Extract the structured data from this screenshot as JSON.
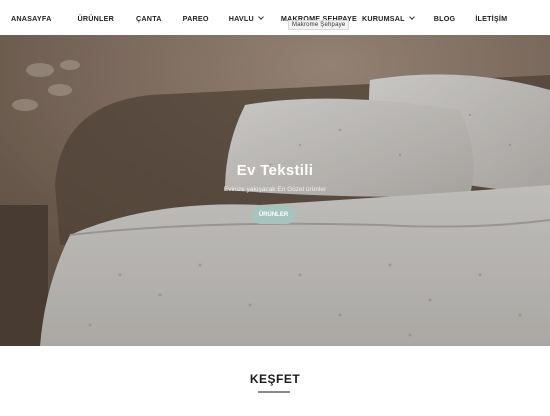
{
  "nav": {
    "items": [
      {
        "label": "ANASAYFA",
        "has_dropdown": false
      },
      {
        "label": "ÜRÜNLER",
        "has_dropdown": false
      },
      {
        "label": "ÇANTA",
        "has_dropdown": false
      },
      {
        "label": "PAREO",
        "has_dropdown": false
      },
      {
        "label": "HAVLU",
        "has_dropdown": true
      },
      {
        "label": "MAKROME SEHPAYE",
        "has_dropdown": false
      },
      {
        "label": "KURUMSAL",
        "has_dropdown": true
      },
      {
        "label": "BLOG",
        "has_dropdown": false
      },
      {
        "label": "İLETİŞİM",
        "has_dropdown": false
      }
    ],
    "tooltip": "Makrome Şehpaye"
  },
  "hero": {
    "title": "Ev Tekstili",
    "subtitle": "Evinize yakışacak En Güzel ürünler",
    "button_label": "ÜRÜNLER"
  },
  "section": {
    "title": "KEŞFET"
  },
  "colors": {
    "accent_button": "#a7c3bd",
    "nav_text": "#1f1f1f"
  },
  "icons": [
    "chevron-down-icon"
  ]
}
